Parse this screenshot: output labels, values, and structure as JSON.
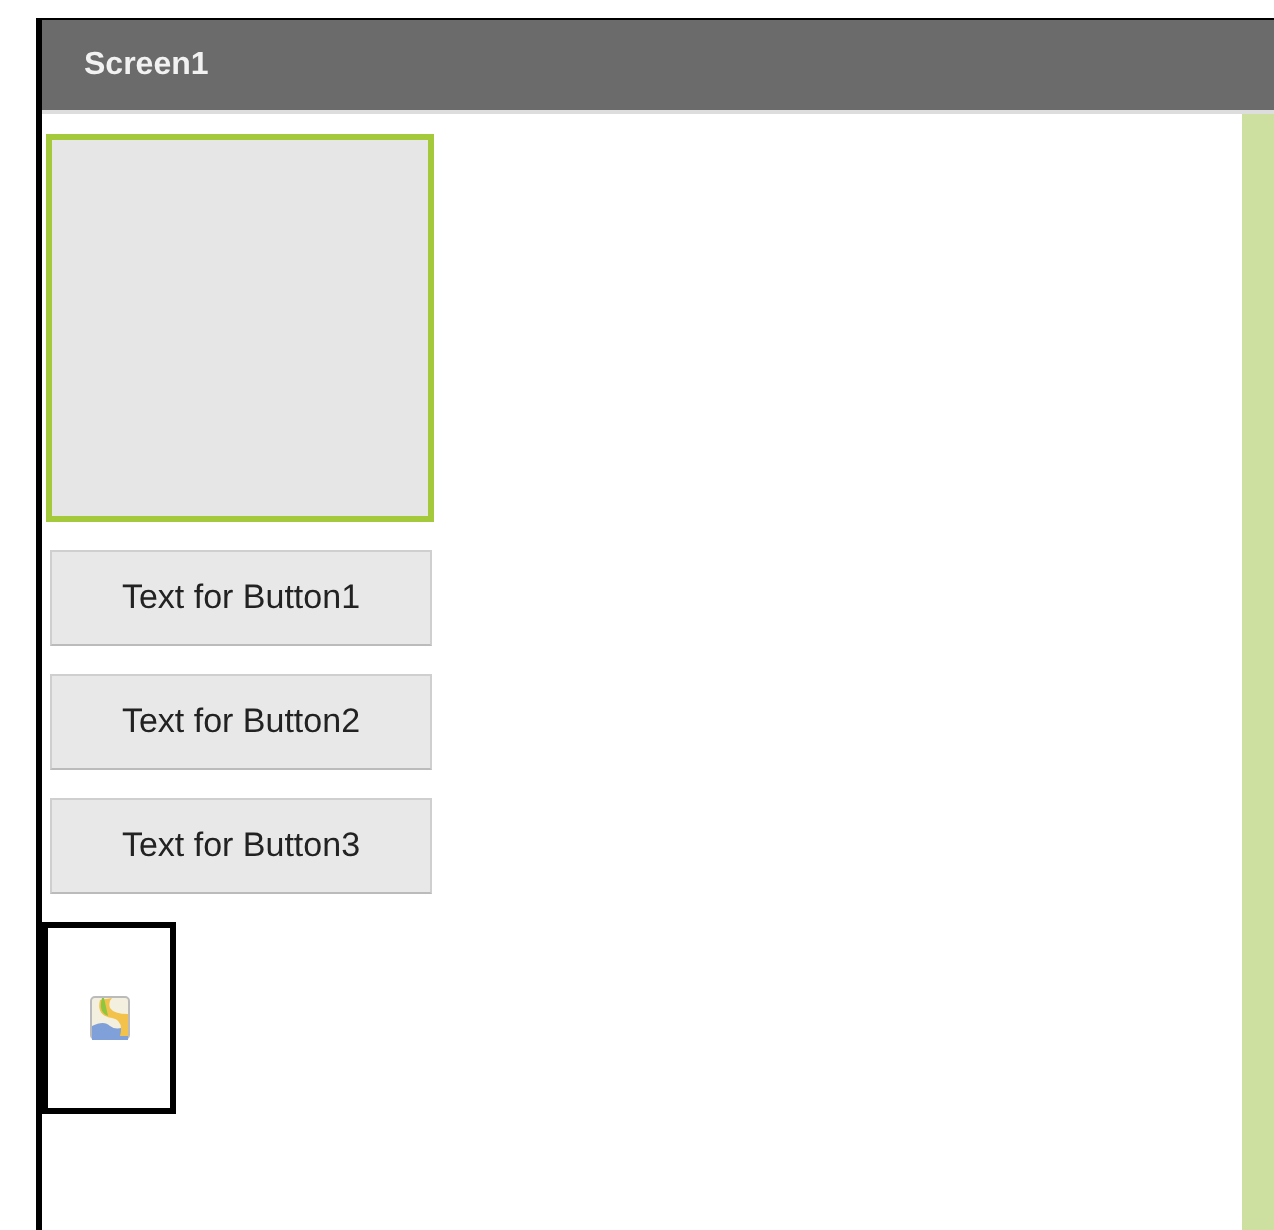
{
  "screen": {
    "title": "Screen1"
  },
  "components": [
    {
      "kind": "arrangement",
      "selected": true
    },
    {
      "kind": "button",
      "label": "Text for Button1",
      "selected": false
    },
    {
      "kind": "button",
      "label": "Text for Button2",
      "selected": false
    },
    {
      "kind": "button",
      "label": "Text for Button3",
      "selected": false
    },
    {
      "kind": "image",
      "selected": true
    }
  ]
}
